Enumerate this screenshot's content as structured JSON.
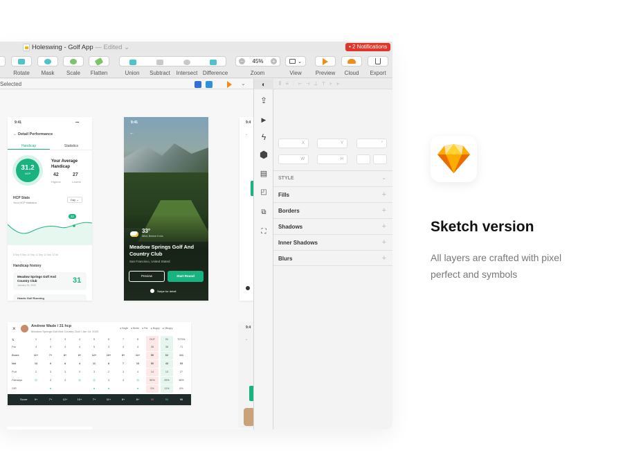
{
  "window": {
    "doc_title": "Holeswing - Golf App",
    "edited": "— Edited ⌄",
    "notifications": "• 2 Notifications"
  },
  "toolbar": {
    "items": [
      {
        "label": "Rotate",
        "icon": "rotate-icon"
      },
      {
        "label": "Mask",
        "icon": "mask-icon"
      },
      {
        "label": "Scale",
        "icon": "scale-icon"
      },
      {
        "label": "Flatten",
        "icon": "flatten-icon"
      },
      {
        "label": "Union",
        "icon": "union-icon"
      },
      {
        "label": "Subtract",
        "icon": "subtract-icon"
      },
      {
        "label": "Intersect",
        "icon": "intersect-icon"
      },
      {
        "label": "Difference",
        "icon": "difference-icon"
      },
      {
        "label": "Zoom",
        "icon": "zoom-icon"
      },
      {
        "label": "View",
        "icon": "view-icon"
      },
      {
        "label": "Preview",
        "icon": "preview-icon"
      },
      {
        "label": "Cloud",
        "icon": "cloud-icon"
      },
      {
        "label": "Export",
        "icon": "export-icon"
      }
    ],
    "zoom_value": "45%",
    "zoom_minus": "−",
    "zoom_plus": "+"
  },
  "subbar": {
    "label": "Selected"
  },
  "detail_screen": {
    "time": "9:41",
    "back_title": "←  Detail Performance",
    "tab_handicap": "Handicap",
    "tab_statistics": "Statistics",
    "score": "31.2",
    "score_unit": "HCP",
    "avg_title": "Your Average Handicap",
    "highest_val": "42",
    "highest_lbl": "Highest",
    "lowest_val": "27",
    "lowest_lbl": "Lowest",
    "stats_title": "HCP Stats",
    "stats_sub": "Your HCP statistics",
    "period": "Day  ⌄",
    "chart_point": "32",
    "dates": "8 Sep    9 Sep    10 Sep    11 Sep    12 Sep    13 Se",
    "history_title": "Handicap history",
    "history_item": "Meadow Springs Golf And Country Club",
    "history_date": "January 16, 2020",
    "history_score": "31",
    "history_next": "Hearts Golf Running"
  },
  "golf_screen": {
    "time": "9:41",
    "temp": "33°",
    "weather": "Wind, Breeze 5 m/s",
    "title": "Meadow Springs Golf And Country Club",
    "location": "San Francisco, United Stated",
    "preview_btn": "Preview",
    "start_btn": "Start Round",
    "swipe": "Swipe for detail"
  },
  "scorecard": {
    "player": "Andrew Wade / 31 hcp",
    "course": "Meadow Springs Golf And Country Club / Jan 16, 2020",
    "legend": [
      "Eagle",
      "Birdie",
      "Par",
      "Bogey",
      "2Bogey"
    ],
    "header": [
      "",
      "1",
      "2",
      "3",
      "4",
      "5",
      "6",
      "7",
      "8",
      "OUT",
      "IN",
      "TOTAL"
    ],
    "rows": [
      {
        "label": "Par",
        "cells": [
          "4",
          "5",
          "4",
          "4",
          "5",
          "3",
          "4",
          "4",
          "35",
          "36",
          "71"
        ]
      },
      {
        "label": "Score",
        "cells": [
          "11+",
          "7+",
          "8+",
          "8+",
          "12+",
          "10+",
          "8+",
          "11+",
          "50",
          "62",
          "111"
        ]
      },
      {
        "label": "Net",
        "cells": [
          "13",
          "6",
          "8",
          "4",
          "11",
          "8",
          "7",
          "10",
          "50",
          "43",
          "93"
        ]
      },
      {
        "label": "Putt",
        "cells": [
          "2",
          "3",
          "3",
          "0",
          "3",
          "2",
          "3",
          "4",
          "14",
          "13",
          "27"
        ]
      },
      {
        "label": "Fairways",
        "cells": [
          "◎",
          "4",
          "4",
          "◎",
          "◎",
          "4",
          "4",
          "◎",
          "50%",
          "25%",
          "38%"
        ]
      },
      {
        "label": "GIR",
        "cells": [
          "",
          "●",
          "",
          "",
          "●",
          "●",
          "",
          "●",
          "0%",
          "11%",
          "6%"
        ]
      }
    ],
    "footer_label": "Score",
    "footer_cells": [
      "9+",
      "7+",
      "12+",
      "10+",
      "7+",
      "11+",
      "8+",
      "8+",
      "50",
      "50",
      "96"
    ]
  },
  "sidebar_icons": [
    "inspector-icon",
    "upload-icon",
    "play-icon",
    "prototype-icon",
    "symbol-icon",
    "layout-icon",
    "frame-icon",
    "image-edit-icon",
    "add-image-icon"
  ],
  "inspector": {
    "x_label": "X",
    "y_label": "Y",
    "w_label": "W",
    "h_label": "H",
    "rotation_label": "°",
    "style_label": "STYLE",
    "sections": [
      "Fills",
      "Borders",
      "Shadows",
      "Inner Shadows",
      "Blurs"
    ],
    "plus": "+"
  },
  "promo": {
    "heading": "Sketch version",
    "description": "All layers are crafted with pixel perfect and symbols",
    "logo": "sketch-logo-icon"
  },
  "colors": {
    "accent_green": "#19b37f",
    "notification_red": "#e0352b",
    "sketch_orange": "#f7a100"
  }
}
